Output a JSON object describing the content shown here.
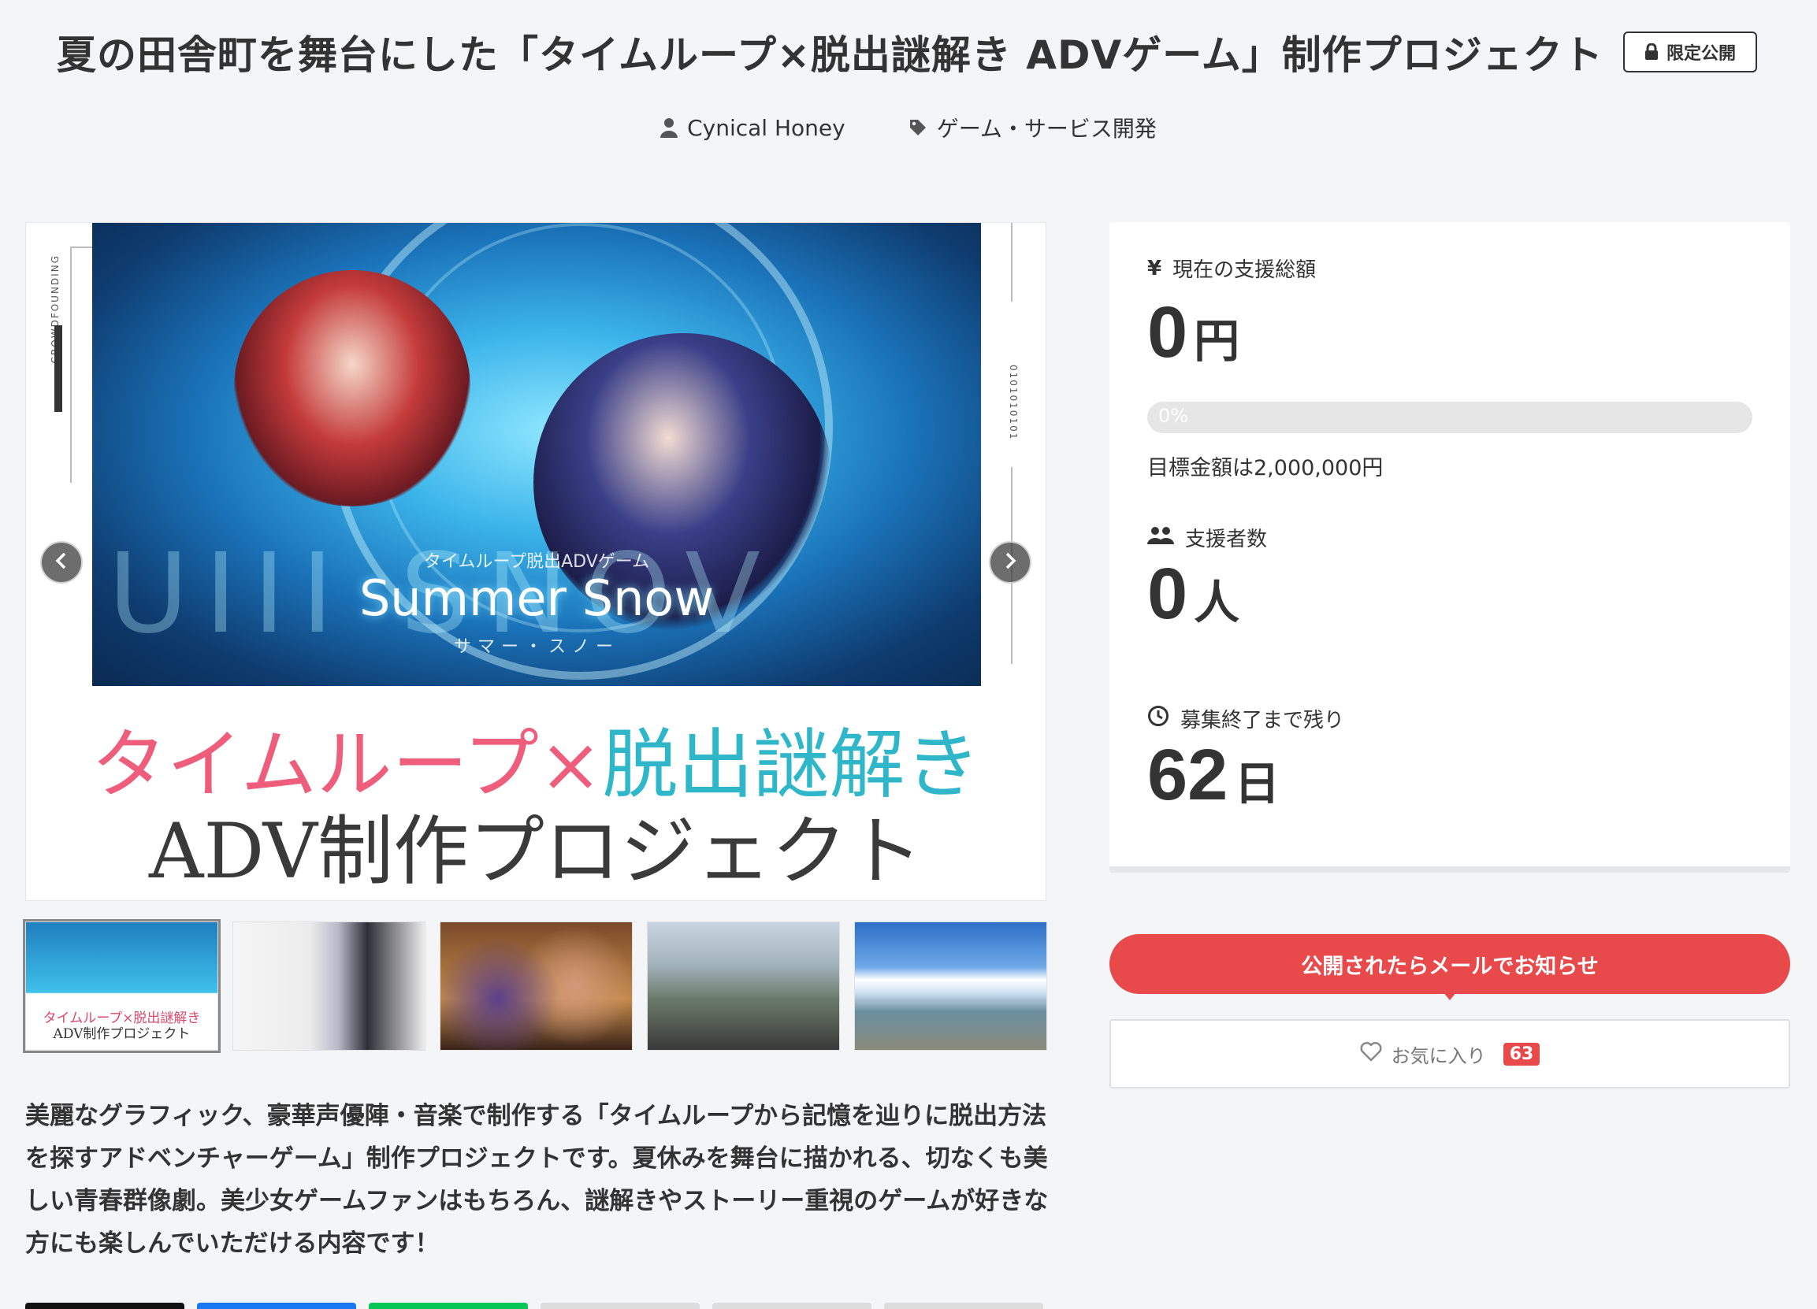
{
  "header": {
    "title": "夏の田舎町を舞台にした「タイムループ×脱出謎解き ADVゲーム」制作プロジェクト",
    "limited_badge": "限定公開"
  },
  "meta": {
    "owner": "Cynical Honey",
    "category": "ゲーム・サービス開発"
  },
  "main_visual": {
    "side_label_left": "CROWDFOUNDING",
    "side_label_right": "0101010101",
    "bg_text": "UIII SNOV",
    "art_subtitle": "タイムループ脱出ADVゲーム",
    "art_title": "Summer Snow",
    "art_kana": "サマー・スノー",
    "catch_pink": "タイムループ",
    "catch_times": "×",
    "catch_blue": "脱出謎解き",
    "catch_line2": "ADV制作プロジェクト"
  },
  "thumbnails": {
    "t1_line1": "タイムループ×脱出謎解き",
    "t1_line2": "ADV制作プロジェクト"
  },
  "description": "美麗なグラフィック、豪華声優陣・音楽で制作する「タイムループから記憶を辿りに脱出方法を探すアドベンチャーゲーム」制作プロジェクトです。夏休みを舞台に描かれる、切なくも美しい青春群像劇。美少女ゲームファンはもちろん、謎解きやストーリー重視のゲームが好きな方にも楽しんでいただける内容です！",
  "stats": {
    "total_label": "現在の支援総額",
    "total_value": "0",
    "total_unit": "円",
    "progress_text": "0%",
    "progress_fraction": 0,
    "goal_text": "目標金額は2,000,000円",
    "backers_label": "支援者数",
    "backers_value": "0",
    "backers_unit": "人",
    "remaining_label": "募集終了まで残り",
    "remaining_value": "62",
    "remaining_unit": "日"
  },
  "actions": {
    "notify_label": "公開されたらメールでお知らせ",
    "favorite_label": "お気に入り",
    "favorite_count": "63"
  },
  "colors": {
    "accent": "#e8494b",
    "share": [
      "#111111",
      "#1877f2",
      "#06c755",
      "#dddddd",
      "#dddddd",
      "#dddddd"
    ]
  }
}
